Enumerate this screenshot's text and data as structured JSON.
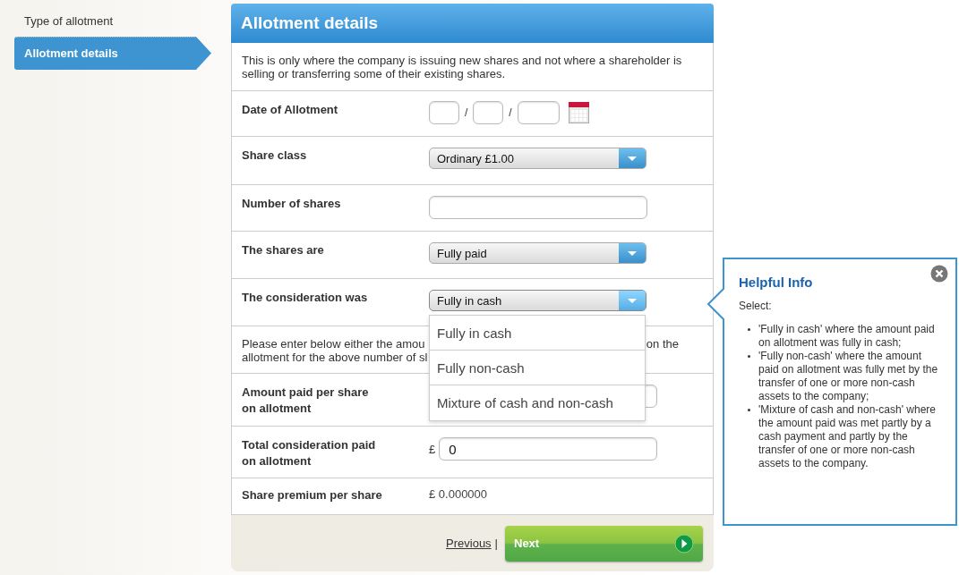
{
  "sidebar": {
    "items": [
      {
        "label": "Type of allotment",
        "selected": false
      },
      {
        "label": "Allotment details",
        "selected": true
      }
    ]
  },
  "panel": {
    "title": "Allotment details",
    "intro": "This is only where the company is issuing new shares and not where a shareholder is selling or transferring some of their existing shares.",
    "fields": [
      {
        "kind": "date",
        "label": "Date of Allotment",
        "separators": [
          "/",
          "/"
        ]
      },
      {
        "kind": "select",
        "label": "Share class",
        "value": "Ordinary £1.00",
        "expanded": false
      },
      {
        "kind": "text",
        "label": "Number of shares"
      },
      {
        "kind": "select",
        "label": "The shares are",
        "value": "Fully paid",
        "expanded": false
      },
      {
        "kind": "select",
        "label": "The consideration was",
        "value": "Fully in cash",
        "expanded": true,
        "options": [
          "Fully in cash",
          "Fully non-cash",
          "Mixture of cash and non-cash"
        ]
      },
      {
        "kind": "note",
        "lines": [
          "Please enter below either the amou",
          "allotment for the above number of sl"
        ],
        "right": "on the"
      },
      {
        "kind": "money",
        "label": "Amount paid per share\non allotment"
      },
      {
        "kind": "money",
        "label": "Total consideration paid\non allotment",
        "currency": "£",
        "value": "0"
      },
      {
        "kind": "readout",
        "label": "Share premium per share",
        "value": "£ 0.000000"
      }
    ]
  },
  "footer": {
    "previous": "Previous",
    "separator": "|",
    "next": "Next"
  },
  "help": {
    "title": "Helpful Info",
    "lead": "Select:",
    "items": [
      "'Fully in cash' where the amount paid on allotment was fully in cash;",
      "'Fully non-cash' where the amount paid on allotment was fully met by the transfer of one or more non-cash assets to the company;",
      "'Mixture of cash and non-cash' where the amount paid was met partly by a cash payment and partly by the transfer of one or more non-cash assets to the company."
    ]
  }
}
